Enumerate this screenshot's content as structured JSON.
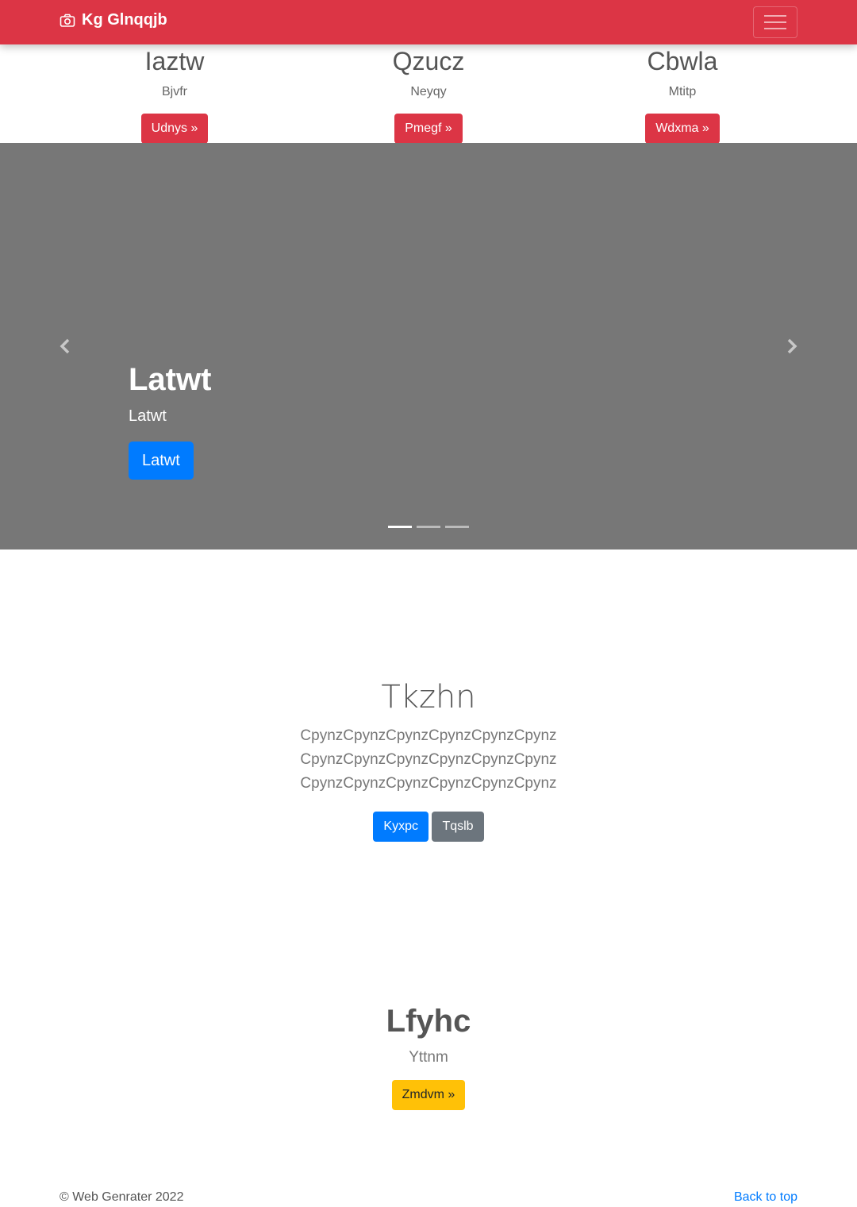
{
  "navbar": {
    "brand": "Kg Glnqqjb",
    "brand_icon": "camera-icon",
    "toggler_icon": "hamburger-icon",
    "background": "#dc3545"
  },
  "features": [
    {
      "title": "Iaztw",
      "text": "Bjvfr",
      "button": "Udnys »"
    },
    {
      "title": "Qzucz",
      "text": "Neyqy",
      "button": "Pmegf »"
    },
    {
      "title": "Cbwla",
      "text": "Mtitp",
      "button": "Wdxma »"
    }
  ],
  "carousel": {
    "caption_title": "Latwt",
    "caption_text": "Latwt",
    "caption_button": "Latwt",
    "prev_icon": "chevron-left-icon",
    "next_icon": "chevron-right-icon",
    "indicator_count": 3,
    "active_indicator": 1,
    "background": "#777777"
  },
  "jumbotron": {
    "title": "Tkzhn",
    "text": "CpynzCpynzCpynzCpynzCpynzCpynzCpynzCpynzCpynzCpynzCpynzCpynzCpynzCpynzCpynzCpynzCpynzCpynz",
    "primary_button": "Kyxpc",
    "secondary_button": "Tqslb"
  },
  "lower": {
    "title": "Lfyhc",
    "text": "Yttnm",
    "button": "Zmdvm »"
  },
  "footer": {
    "copyright": "© Web Genrater 2022",
    "back_to_top": "Back to top"
  }
}
